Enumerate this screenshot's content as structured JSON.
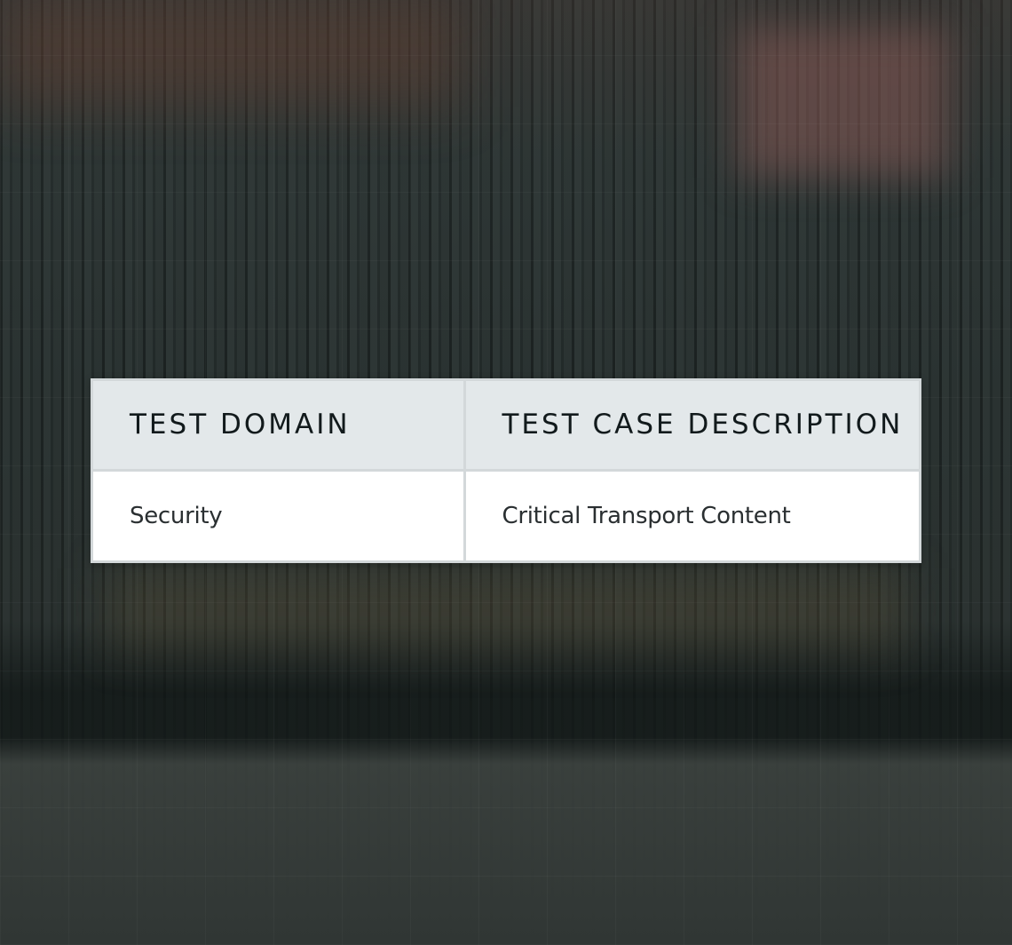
{
  "table": {
    "headers": [
      "TEST DOMAIN",
      "TEST CASE DESCRIPTION"
    ],
    "rows": [
      [
        "Security",
        "Critical Transport Content"
      ]
    ]
  },
  "colors": {
    "header_background": "#e3e8ea",
    "header_text": "#121a1c",
    "cell_background": "#ffffff",
    "cell_text": "#2a2f31",
    "border": "#d3d8da",
    "backdrop": "#2d3534"
  }
}
